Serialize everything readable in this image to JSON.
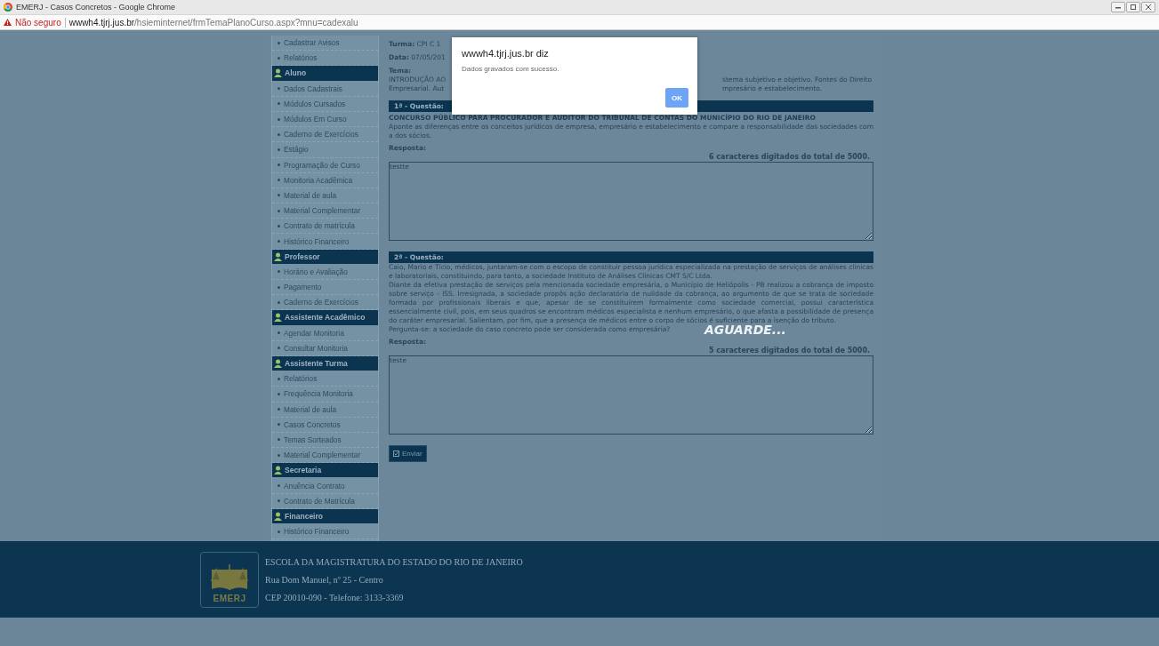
{
  "browser": {
    "title": "EMERJ - Casos Concretos - Google Chrome",
    "insecure_label": "Não seguro",
    "url_host": "wwwh4.tjrj.jus.br",
    "url_path": "/hsieminternet/frmTemaPlanoCurso.aspx?mnu=cadexalu"
  },
  "sidebar": [
    {
      "kind": "item",
      "label": "Cadastrar Avisos"
    },
    {
      "kind": "item",
      "label": "Relatórios"
    },
    {
      "kind": "header",
      "label": "Aluno"
    },
    {
      "kind": "item",
      "label": "Dados Cadastrais"
    },
    {
      "kind": "item",
      "label": "Módulos Cursados"
    },
    {
      "kind": "item",
      "label": "Módulos Em Curso"
    },
    {
      "kind": "item",
      "label": "Caderno de Exercícios"
    },
    {
      "kind": "item",
      "label": "Estágio"
    },
    {
      "kind": "item",
      "label": "Programação de Curso"
    },
    {
      "kind": "item",
      "label": "Monitoria Acadêmica"
    },
    {
      "kind": "item",
      "label": "Material de aula"
    },
    {
      "kind": "item",
      "label": "Material Complementar"
    },
    {
      "kind": "item",
      "label": "Contrato de matrícula"
    },
    {
      "kind": "item",
      "label": "Histórico Financeiro"
    },
    {
      "kind": "header",
      "label": "Professor"
    },
    {
      "kind": "item",
      "label": "Horário e Avaliação"
    },
    {
      "kind": "item",
      "label": "Pagamento"
    },
    {
      "kind": "item",
      "label": "Caderno de Exercícios"
    },
    {
      "kind": "header",
      "label": "Assistente Acadêmico"
    },
    {
      "kind": "item",
      "label": "Agendar Monitoria"
    },
    {
      "kind": "item",
      "label": "Consultar Monitoria"
    },
    {
      "kind": "header",
      "label": "Assistente Turma"
    },
    {
      "kind": "item",
      "label": "Relatórios"
    },
    {
      "kind": "item",
      "label": "Frequência Monitoria"
    },
    {
      "kind": "item",
      "label": "Material de aula"
    },
    {
      "kind": "item",
      "label": "Casos Concretos"
    },
    {
      "kind": "item",
      "label": "Temas Sorteados"
    },
    {
      "kind": "item",
      "label": "Material Complementar"
    },
    {
      "kind": "header",
      "label": "Secretaria"
    },
    {
      "kind": "item",
      "label": "Anuência Contrato"
    },
    {
      "kind": "item",
      "label": "Contrato de Matrícula"
    },
    {
      "kind": "header",
      "label": "Financeiro"
    },
    {
      "kind": "item",
      "label": "Histórico Financeiro"
    }
  ],
  "class_info": {
    "turma_label": "Turma:",
    "turma_value": "CPI C 1",
    "data_label": "Data:",
    "data_value": "07/05/201",
    "tema_label": "Tema:",
    "tema_lines": [
      {
        "left": "INTRODUÇÃO AO",
        "right": "stema subjetivo e objetivo. Fontes do Direito"
      },
      {
        "left": "Empresarial. Aut",
        "right": "mpresário e estabelecimento."
      }
    ]
  },
  "questions": [
    {
      "header": "1ª - Questão:",
      "title": "CONCURSO PÚBLICO PARA PROCURADOR E AUDITOR DO TRIBUNAL DE CONTAS DO MUNICÍPIO DO RIO DE JANEIRO",
      "paragraphs": [
        "Aponte as diferenças entre os conceitos jurídicos de empresa, empresário e estabelecimento e compare a responsabilidade das sociedades com a dos sócios."
      ],
      "answer_label": "Resposta:",
      "counter": "6 caracteres digitados do total de 5000.",
      "answer": "testte"
    },
    {
      "header": "2ª - Questão:",
      "paragraphs": [
        "Caio, Mario e Tício, médicos, juntaram-se com o escopo de constituir pessoa jurídica especializada na prestação de serviços de análises clínicas e laboratoriais, constituindo, para tanto, a sociedade Instituto de Análises Clínicas CMT S/C Ltda.",
        "Diante da efetiva prestação de serviços pela mencionada sociedade empresária, o Município de Heliópolis - PB realizou a cobrança de imposto sobre serviço - ISS. Irresignada, a sociedade propôs ação declaratória de nulidade da cobrança, ao argumento de que se trata de sociedade formada por profissionais liberais e que, apesar de se constituírem formalmente como sociedade comercial, possui característica essencialmente civil, pois, em seus quadros se encontram médicos especialista e nenhum empresário, o que afasta a possibilidade de presença do caráter empresarial. Salientam, por fim, que a presença de médicos entre o corpo de sócios é suficiente para a isenção do tributo.",
        "Pergunta-se: a sociedade do caso concreto pode ser considerada como empresária?"
      ],
      "answer_label": "Resposta:",
      "counter": "5 caracteres digitados do total de 5000.",
      "answer": "teste"
    }
  ],
  "submit_button": "Enviar",
  "loading_text": "AGUARDE...",
  "dialog": {
    "origin": "wwwh4.tjrj.jus.br diz",
    "message": "Dados gravados com sucesso.",
    "ok": "OK"
  },
  "footer": {
    "logo_text": "EMERJ",
    "lines": [
      "ESCOLA DA MAGISTRATURA DO ESTADO DO RIO DE JANEIRO",
      "Rua Dom Manuel, nº 25 - Centro",
      "CEP 20010-090 - Telefone: 3133-3369"
    ]
  }
}
